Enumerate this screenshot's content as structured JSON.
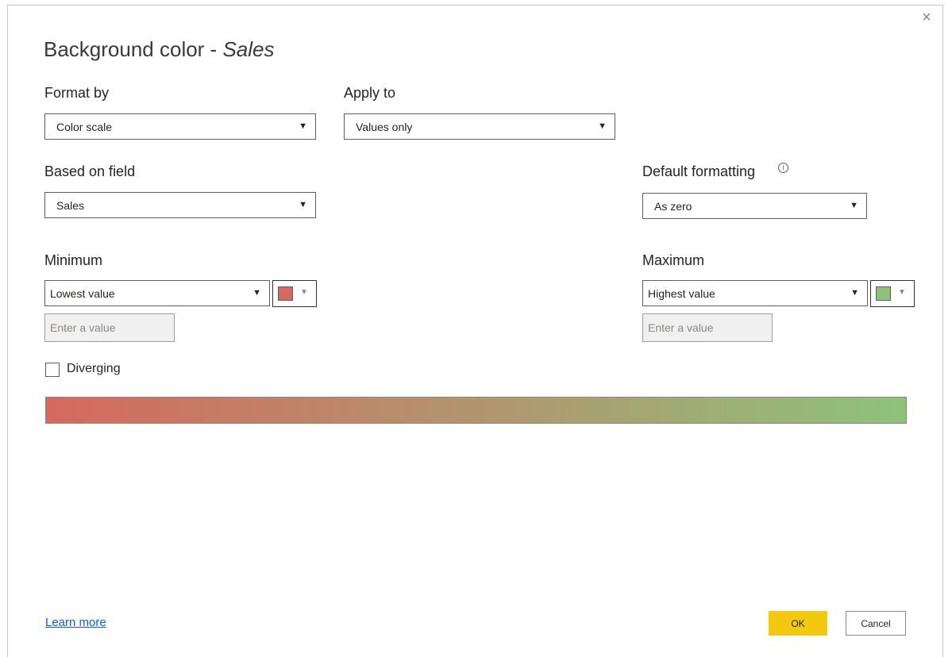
{
  "dialog": {
    "title_prefix": "Background color - ",
    "title_field": "Sales",
    "close_glyph": "×"
  },
  "format_by": {
    "label": "Format by",
    "value": "Color scale"
  },
  "apply_to": {
    "label": "Apply to",
    "value": "Values only"
  },
  "based_on_field": {
    "label": "Based on field",
    "value": "Sales"
  },
  "default_formatting": {
    "label": "Default formatting",
    "info_glyph": "i",
    "value": "As zero"
  },
  "minimum": {
    "label": "Minimum",
    "value": "Lowest value",
    "color": "#d5695f",
    "input_placeholder": "Enter a value"
  },
  "maximum": {
    "label": "Maximum",
    "value": "Highest value",
    "color": "#8ec27b",
    "input_placeholder": "Enter a value"
  },
  "diverging": {
    "label": "Diverging",
    "checked": false
  },
  "gradient": {
    "from": "#d5695f",
    "to": "#8ec27b"
  },
  "footer": {
    "learn_more": "Learn more",
    "ok_label": "OK",
    "cancel_label": "Cancel"
  },
  "colors": {
    "accent": "#f2c811",
    "link": "#0f5bd8"
  },
  "dropdown_arrow": "▼",
  "swatch_caret": "▼"
}
